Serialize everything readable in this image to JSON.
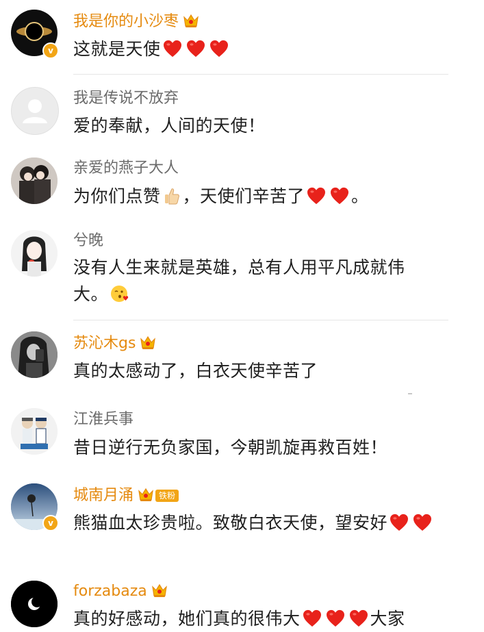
{
  "comments": [
    {
      "username": "我是你的小沙枣",
      "vip": true,
      "badge": "",
      "text": "这就是天使",
      "hearts": 3
    },
    {
      "username": "我是传说不放弃",
      "vip": false,
      "badge": "",
      "text": "爱的奉献，人间的天使！",
      "hearts": 0
    },
    {
      "username": "亲爱的燕子大人",
      "vip": false,
      "badge": "",
      "text_before": "为你们点赞",
      "text_after": "，天使们辛苦了",
      "text_end": "。",
      "hearts": 2
    },
    {
      "username": "兮晚",
      "vip": false,
      "badge": "",
      "text": "没有人生来就是英雄，总有人用平凡成就伟大。",
      "hearts": 0
    },
    {
      "username": "苏沁木gs",
      "vip": true,
      "badge": "",
      "text": "真的太感动了，白衣天使辛苦了",
      "hearts": 0
    },
    {
      "username": "江淮兵事",
      "vip": false,
      "badge": "",
      "text": "昔日逆行无负家国，今朝凯旋再救百姓！",
      "hearts": 0
    },
    {
      "username": "城南月涌",
      "vip": true,
      "badge": "铁粉",
      "text": "熊猫血太珍贵啦。致敬白衣天使，望安好",
      "hearts": 2
    },
    {
      "username": "forzabaza",
      "vip": true,
      "badge": "",
      "text_before": "真的好感动，她们真的很伟大",
      "text_after": "大家",
      "hearts": 3
    }
  ],
  "colors": {
    "vip_name": "#e58a0f",
    "plain_name": "#6b6b6b",
    "heart": "#e8221b",
    "verified": "#f2a516"
  }
}
